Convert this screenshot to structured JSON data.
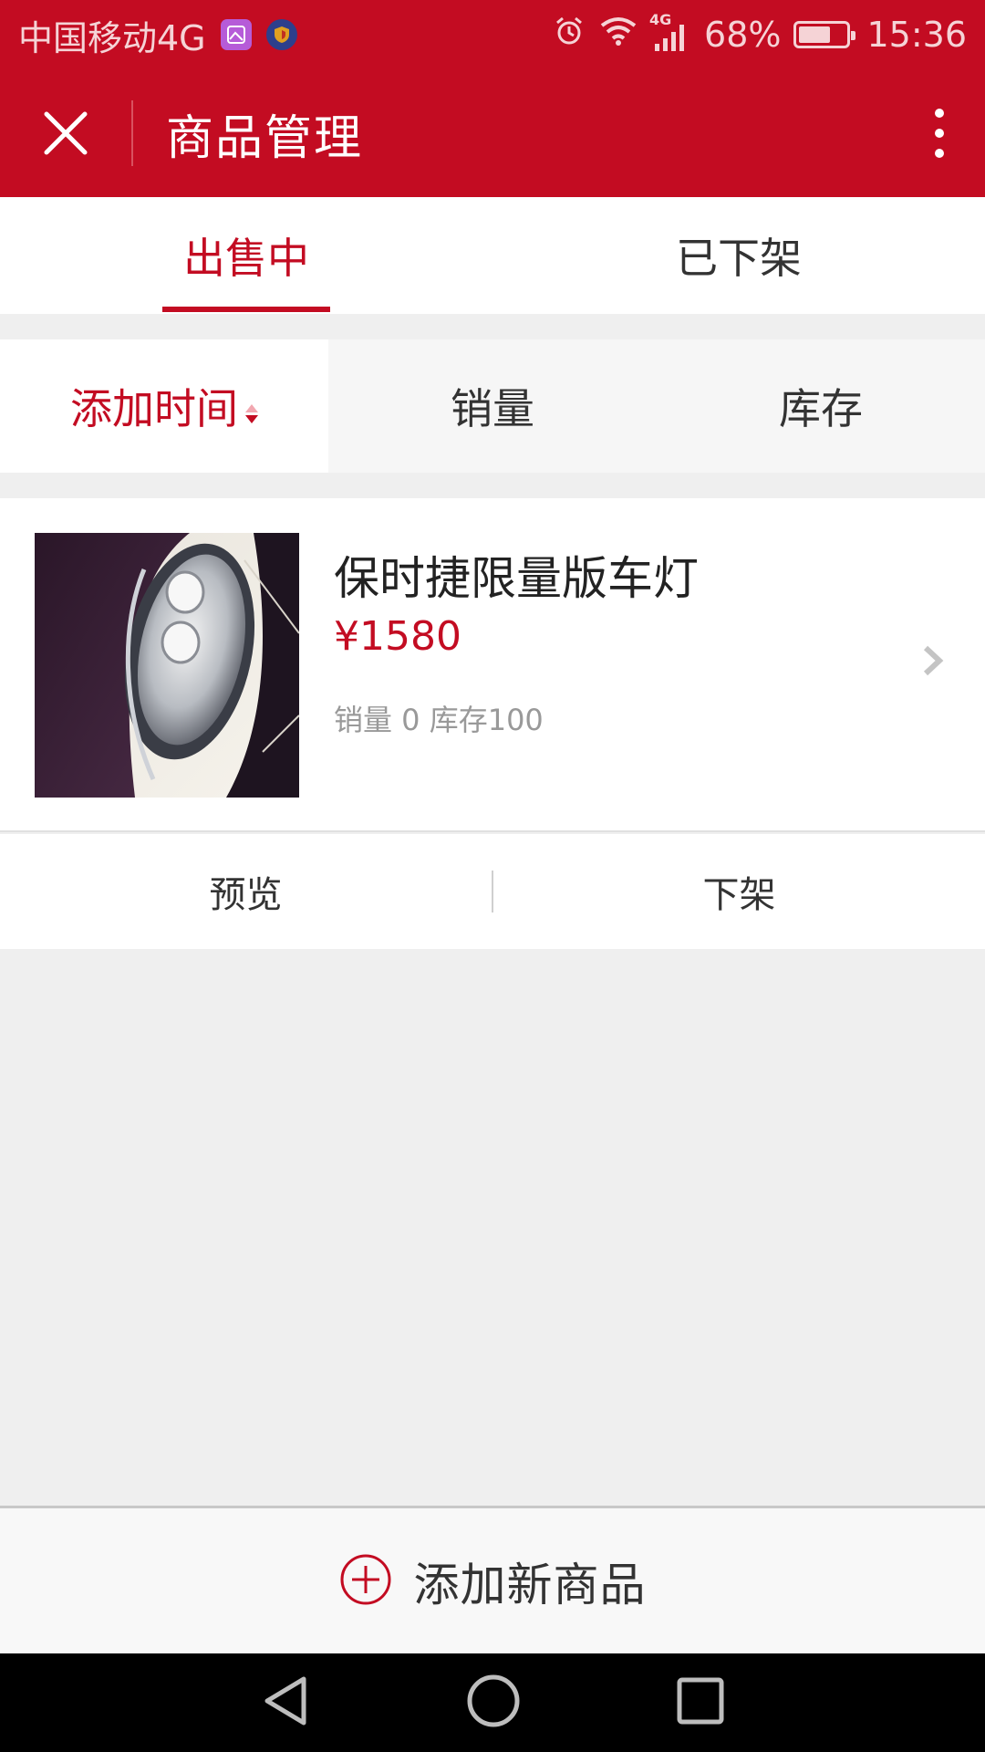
{
  "status_bar": {
    "carrier": "中国移动4G",
    "network": "4G",
    "battery": "68%",
    "battery_level": 0.68,
    "time": "15:36"
  },
  "header": {
    "title": "商品管理",
    "close_icon": "close-icon",
    "more_icon": "more-vertical-icon"
  },
  "tabs": [
    {
      "label": "出售中",
      "active": true
    },
    {
      "label": "已下架",
      "active": false
    }
  ],
  "sort": [
    {
      "label": "添加时间",
      "active": true
    },
    {
      "label": "销量",
      "active": false
    },
    {
      "label": "库存",
      "active": false
    }
  ],
  "product": {
    "name": "保时捷限量版车灯",
    "price": "¥1580",
    "stats": "销量 0 库存100",
    "actions": {
      "preview": "预览",
      "delist": "下架"
    }
  },
  "add_bar": {
    "label": "添加新商品"
  },
  "colors": {
    "brand": "#c30c22",
    "background": "#efefef"
  }
}
